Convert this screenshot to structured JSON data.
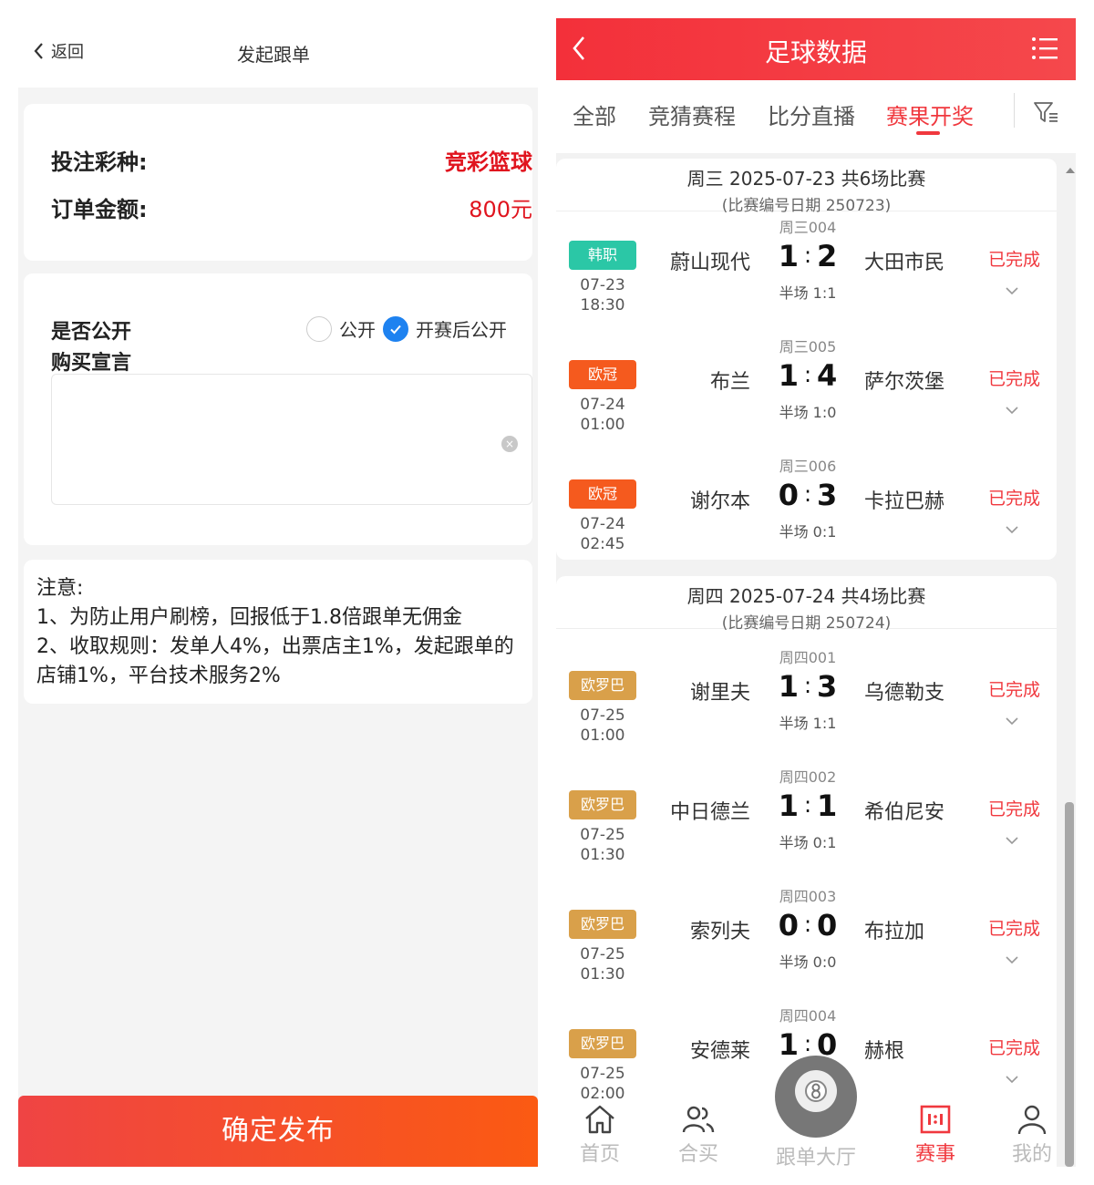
{
  "left": {
    "back_label": "返回",
    "title": "发起跟单",
    "bet_type_label": "投注彩种:",
    "bet_type_value": "竞彩篮球",
    "amount_label": "订单金额:",
    "amount_value": "800元",
    "public_label": "是否公开",
    "declaration_label": "购买宣言",
    "radio_public": "公开",
    "radio_after_start": "开赛后公开",
    "declaration_value": "",
    "note_title": "注意:",
    "note_1": " 1、为防止用户刷榜，回报低于1.8倍跟单无佣金",
    "note_2": " 2、收取规则：发单人4%，出票店主1%，发起跟单的",
    "note_3": "店铺1%，平台技术服务2%",
    "submit_label": "确定发布",
    "colors": {
      "accent": "#e0141e",
      "button_from": "#ef4444",
      "button_to": "#fb5a12",
      "radio_checked": "#1e82f0"
    }
  },
  "right": {
    "title": "足球数据",
    "tabs": [
      "全部",
      "竞猜赛程",
      "比分直播",
      "赛果开奖"
    ],
    "active_tab": "赛果开奖",
    "days": [
      {
        "title": "周三 2025-07-23 共6场比赛",
        "subtitle": "(比赛编号日期 250723)",
        "matches": [
          {
            "code": "周三004",
            "league": "韩职",
            "league_color": "#2bc7a6",
            "date": "07-23",
            "time": "18:30",
            "home": "蔚山现代",
            "home_goals": "1",
            "away_goals": "2",
            "away": "大田市民",
            "half": "半场 1:1",
            "status": "已完成"
          },
          {
            "code": "周三005",
            "league": "欧冠",
            "league_color": "#f55a1e",
            "date": "07-24",
            "time": "01:00",
            "home": "布兰",
            "home_goals": "1",
            "away_goals": "4",
            "away": "萨尔茨堡",
            "half": "半场 1:0",
            "status": "已完成"
          },
          {
            "code": "周三006",
            "league": "欧冠",
            "league_color": "#f55a1e",
            "date": "07-24",
            "time": "02:45",
            "home": "谢尔本",
            "home_goals": "0",
            "away_goals": "3",
            "away": "卡拉巴赫",
            "half": "半场 0:1",
            "status": "已完成"
          }
        ]
      },
      {
        "title": "周四 2025-07-24 共4场比赛",
        "subtitle": "(比赛编号日期 250724)",
        "matches": [
          {
            "code": "周四001",
            "league": "欧罗巴",
            "league_color": "#d9a04a",
            "date": "07-25",
            "time": "01:00",
            "home": "谢里夫",
            "home_goals": "1",
            "away_goals": "3",
            "away": "乌德勒支",
            "half": "半场 1:1",
            "status": "已完成"
          },
          {
            "code": "周四002",
            "league": "欧罗巴",
            "league_color": "#d9a04a",
            "date": "07-25",
            "time": "01:30",
            "home": "中日德兰",
            "home_goals": "1",
            "away_goals": "1",
            "away": "希伯尼安",
            "half": "半场 0:1",
            "status": "已完成"
          },
          {
            "code": "周四003",
            "league": "欧罗巴",
            "league_color": "#d9a04a",
            "date": "07-25",
            "time": "01:30",
            "home": "索列夫",
            "home_goals": "0",
            "away_goals": "0",
            "away": "布拉加",
            "half": "半场 0:0",
            "status": "已完成"
          },
          {
            "code": "周四004",
            "league": "欧罗巴",
            "league_color": "#d9a04a",
            "date": "07-25",
            "time": "02:00",
            "home": "安德莱",
            "home_goals": "1",
            "away_goals": "0",
            "away": "赫根",
            "half": "",
            "status": "已完成"
          }
        ]
      }
    ],
    "bottom_nav": [
      {
        "label": "首页",
        "icon": "home-icon"
      },
      {
        "label": "合买",
        "icon": "group-icon"
      },
      {
        "label": "跟单大厅",
        "icon": "ball-icon"
      },
      {
        "label": "赛事",
        "icon": "score-board-icon"
      },
      {
        "label": "我的",
        "icon": "user-icon"
      }
    ],
    "active_nav": "赛事",
    "colors": {
      "header": "#f3303a",
      "active": "#f0383e"
    }
  }
}
